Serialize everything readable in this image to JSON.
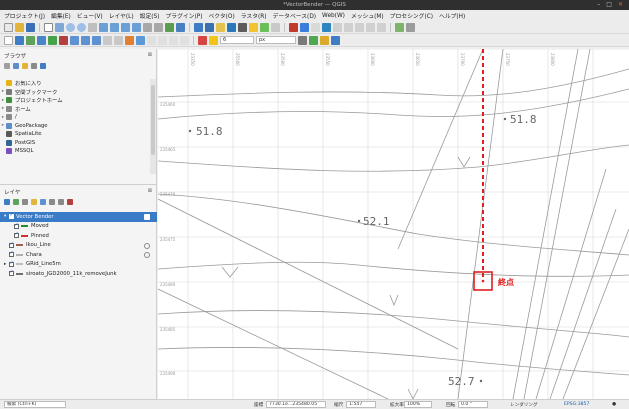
{
  "window": {
    "title": "*VectorBender — QGIS",
    "buttons": [
      "–",
      "□",
      "✕"
    ]
  },
  "menubar": [
    "プロジェクト(J)",
    "編集(E)",
    "ビュー(V)",
    "レイヤ(L)",
    "設定(S)",
    "プラグイン(P)",
    "ベクタ(O)",
    "ラスタ(R)",
    "データベース(D)",
    "Web(W)",
    "メッシュ(M)",
    "プロセシング(C)",
    "ヘルプ(H)"
  ],
  "toolbar2": {
    "scale_field": "6",
    "unit_field": "px"
  },
  "browser_panel": {
    "title": "ブラウザ",
    "items": [
      {
        "label": "お気に入り",
        "icon": "star-icon",
        "color": "#e7b416",
        "expand": ""
      },
      {
        "label": "空間ブックマーク",
        "icon": "bookmark-icon",
        "color": "#7a7a7a",
        "expand": "▸"
      },
      {
        "label": "プロジェクトホーム",
        "icon": "home-folder-icon",
        "color": "#3f8f3f",
        "expand": "▸"
      },
      {
        "label": "ホーム",
        "icon": "folder-icon",
        "color": "#8a8a8a",
        "expand": "▸"
      },
      {
        "label": "/",
        "icon": "folder-icon",
        "color": "#8a8a8a",
        "expand": "▸"
      },
      {
        "label": "GeoPackage",
        "icon": "geopackage-icon",
        "color": "#5b8dc9",
        "expand": "▸"
      },
      {
        "label": "SpatiaLite",
        "icon": "spatialite-icon",
        "color": "#5a5a5a",
        "expand": ""
      },
      {
        "label": "PostGIS",
        "icon": "postgis-icon",
        "color": "#336791",
        "expand": ""
      },
      {
        "label": "MSSQL",
        "icon": "mssql-icon",
        "color": "#7a4fbf",
        "expand": ""
      }
    ]
  },
  "layers_panel": {
    "title": "レイヤ",
    "layers": [
      {
        "label": "Vector Bender",
        "indent": 0,
        "selected": true,
        "legend": "",
        "expand": "▾"
      },
      {
        "label": "Moved",
        "indent": 1,
        "selected": false,
        "legend": "#2a8a2a",
        "expand": ""
      },
      {
        "label": "Pinned",
        "indent": 1,
        "selected": false,
        "legend": "#d03030",
        "expand": ""
      },
      {
        "label": "Ikou_Line",
        "indent": 0,
        "selected": false,
        "legend": "#a06050",
        "expand": ""
      },
      {
        "label": "Chara",
        "indent": 0,
        "selected": false,
        "legend": "#b0b0b0",
        "expand": ""
      },
      {
        "label": "GRid_Line5m",
        "indent": 0,
        "selected": false,
        "legend": "",
        "expand": "▸"
      },
      {
        "label": "siroato_JGD2000_11k_removeJunk",
        "indent": 0,
        "selected": false,
        "legend": "#707070",
        "expand": ""
      }
    ]
  },
  "map": {
    "elevation_labels": [
      "51.8",
      "51.8",
      "52.1",
      "52.7"
    ],
    "x_ticks": [
      "23350",
      "25500",
      "23500",
      "23550",
      "23600",
      "23650",
      "23700",
      "23750",
      "23800"
    ],
    "y_ticks": [
      "235460",
      "235465",
      "235470",
      "235475",
      "235480",
      "235485",
      "235490"
    ],
    "endpoint_label": "終点",
    "endpoint_color": "#e02020",
    "pinned_line_color": "#e02020"
  },
  "statusbar": {
    "search_placeholder": "検索 (Ctrl+K)",
    "coord_label": "座標",
    "coordinate": "7730.1e...235480.05",
    "scale_label": "縮尺",
    "scale": "1:547",
    "magnifier_label": "拡大率",
    "magnifier": "100%",
    "rotation_label": "回転",
    "rotation": "0.0 °",
    "render_label": "レンダリング",
    "crs": "EPSG:3857"
  }
}
